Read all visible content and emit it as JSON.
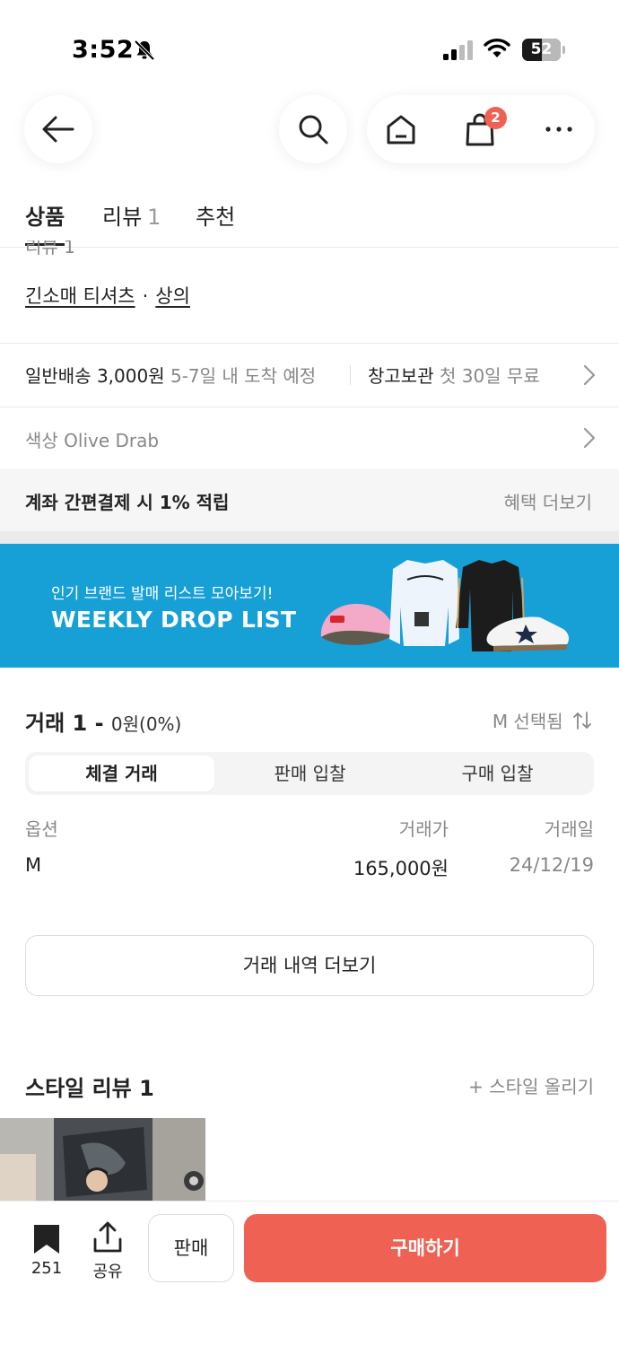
{
  "status_bar": {
    "time": "3:52",
    "battery": "52",
    "battery_level": 0.52
  },
  "header": {
    "cart_count": "2",
    "icons": [
      "back-arrow-icon",
      "search-icon",
      "home-icon",
      "shopping-bag-icon",
      "more-icon"
    ]
  },
  "tabs": [
    {
      "label": "상품",
      "count": "",
      "active": true
    },
    {
      "label": "리뷰",
      "count": "1",
      "active": false
    },
    {
      "label": "추천",
      "count": "",
      "active": false
    }
  ],
  "product": {
    "cutoff_text": "리뷰 1",
    "category_1": "긴소매 티셔츠",
    "category_sep": "·",
    "category_2": "상의"
  },
  "shipping": {
    "standard_label": "일반배송 3,000원",
    "standard_eta": "5-7일 내 도착 예정",
    "warehouse_label": "창고보관",
    "warehouse_note": "첫 30일 무료"
  },
  "color_option": {
    "label": "색상 Olive Drab"
  },
  "benefit": {
    "title": "계좌 간편결제 시 1% 적립",
    "more": "혜택 더보기"
  },
  "banner": {
    "subtitle": "인기 브랜드 발매 리스트 모아보기!",
    "title": "WEEKLY DROP LIST",
    "color": "#17a0d6"
  },
  "trades": {
    "title": "거래 1",
    "dash": "-",
    "amount": "0원(0%)",
    "size_selected": "M 선택됨",
    "segments": [
      "체결 거래",
      "판매 입찰",
      "구매 입찰"
    ],
    "columns": [
      "옵션",
      "거래가",
      "거래일"
    ],
    "rows": [
      {
        "option": "M",
        "price": "165,000원",
        "date": "24/12/19"
      }
    ],
    "more_button": "거래 내역 더보기"
  },
  "style_review": {
    "title": "스타일 리뷰 1",
    "upload": "+ 스타일 올리기"
  },
  "bottom_bar": {
    "bookmark_count": "251",
    "share_label": "공유",
    "sell_label": "판매",
    "buy_label": "구매하기",
    "accent_color": "#ef6253"
  }
}
